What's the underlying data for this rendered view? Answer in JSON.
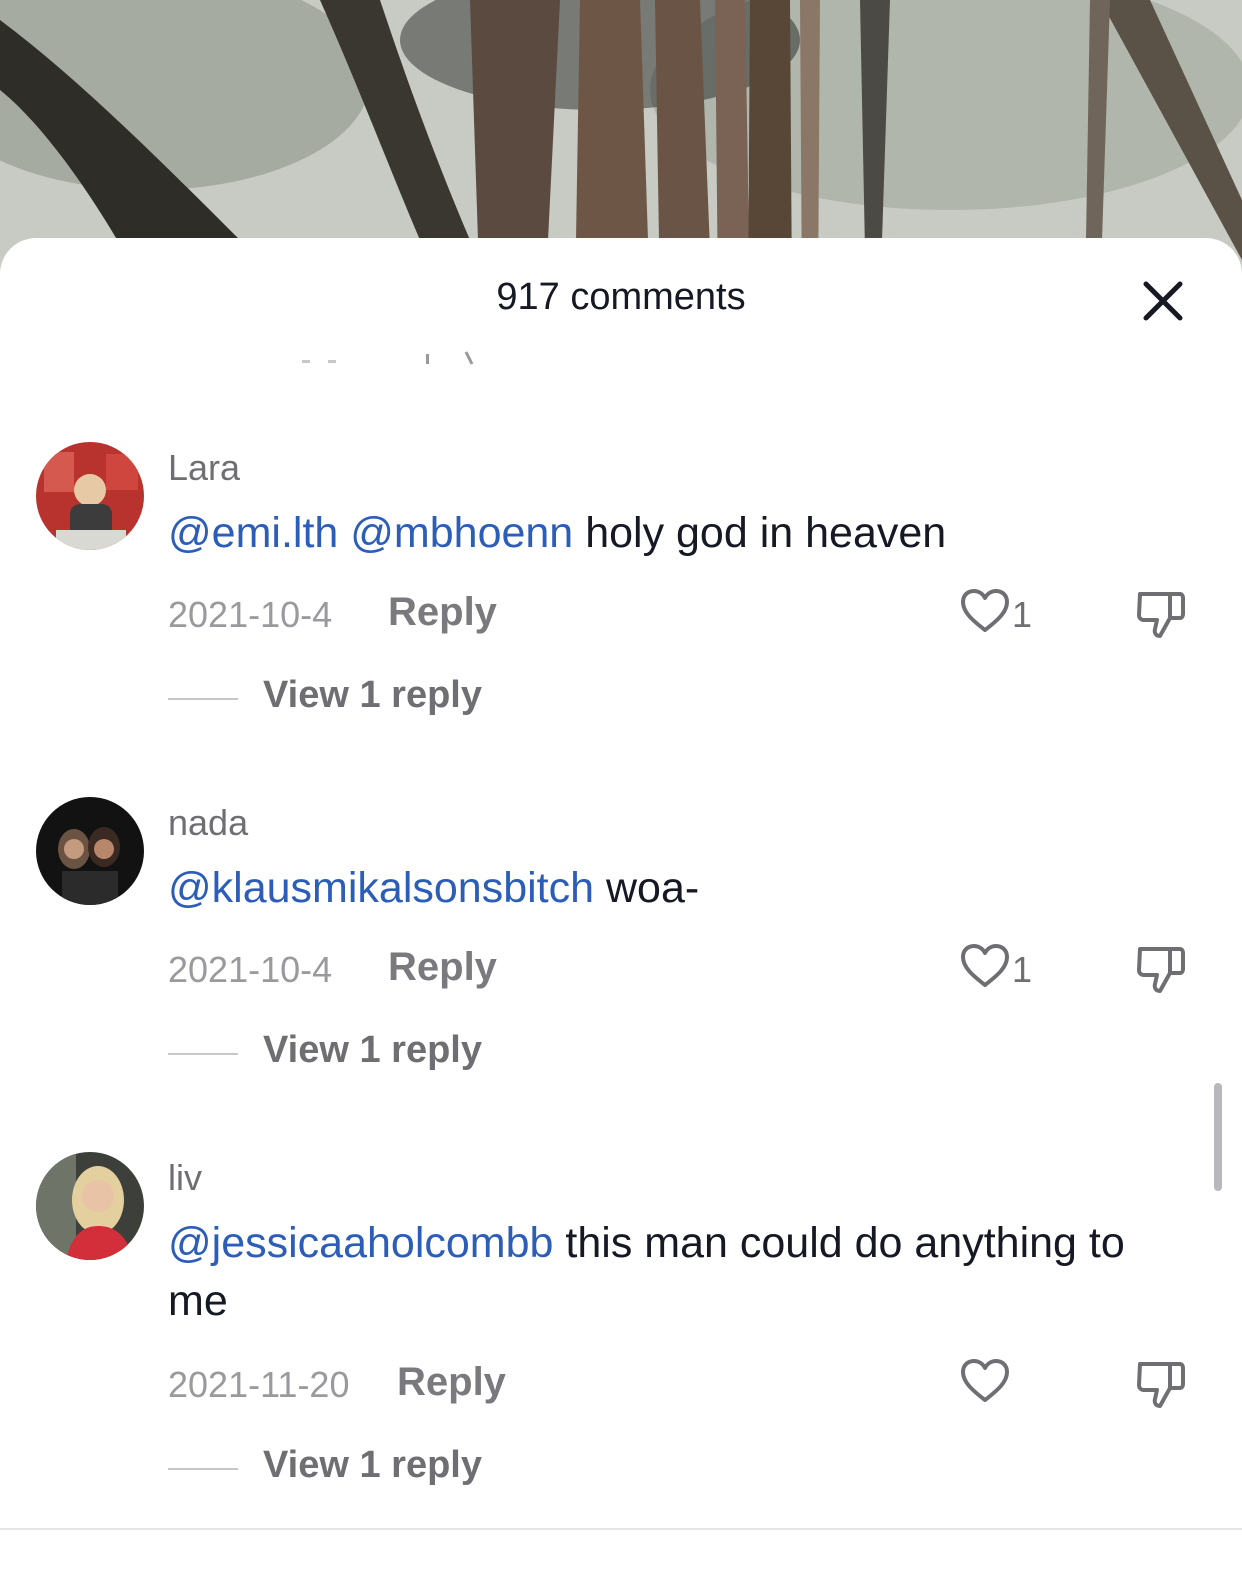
{
  "header": {
    "title": "917 comments"
  },
  "comments": [
    {
      "username": "Lara",
      "mentions": [
        "@emi.lth",
        "@mbhoenn"
      ],
      "text": "holy god in heaven",
      "date": "2021-10-4",
      "reply_label": "Reply",
      "likes": "1",
      "view_replies": "View 1 reply"
    },
    {
      "username": "nada",
      "mentions": [
        "@klausmikalsonsbitch"
      ],
      "text": "woa-",
      "date": "2021-10-4",
      "reply_label": "Reply",
      "likes": "1",
      "view_replies": "View 1 reply"
    },
    {
      "username": "liv",
      "mentions": [
        "@jessicaaholcombb"
      ],
      "text": "this man could do anything to me",
      "date": "2021-11-20",
      "reply_label": "Reply",
      "likes": "",
      "view_replies": "View 1 reply"
    }
  ],
  "colors": {
    "mention": "#2b5db9",
    "text": "#161823",
    "muted": "#6f6f73"
  }
}
